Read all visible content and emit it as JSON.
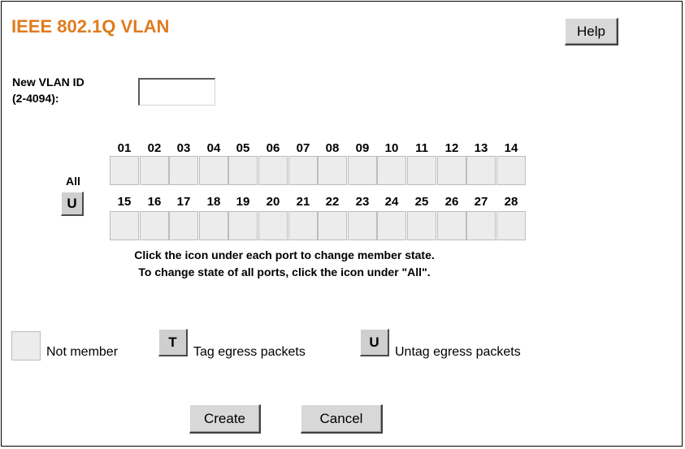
{
  "page": {
    "title": "IEEE 802.1Q VLAN",
    "help_label": "Help"
  },
  "vlan_id": {
    "label_line1": "New VLAN ID",
    "label_line2": "(2-4094):",
    "value": ""
  },
  "ports": {
    "row1": [
      "01",
      "02",
      "03",
      "04",
      "05",
      "06",
      "07",
      "08",
      "09",
      "10",
      "11",
      "12",
      "13",
      "14"
    ],
    "row2": [
      "15",
      "16",
      "17",
      "18",
      "19",
      "20",
      "21",
      "22",
      "23",
      "24",
      "25",
      "26",
      "27",
      "28"
    ],
    "all_label": "All",
    "all_state": "U"
  },
  "instructions": {
    "line1": "Click the icon under each port to change member state.",
    "line2": "To change state of all ports, click the icon under \"All\"."
  },
  "legend": {
    "not_member": "Not member",
    "tag_icon": "T",
    "tag_label": "Tag egress packets",
    "untag_icon": "U",
    "untag_label": "Untag egress packets"
  },
  "actions": {
    "create_label": "Create",
    "cancel_label": "Cancel"
  },
  "colors": {
    "title": "#e07b1f",
    "button_face": "#d8d8d8",
    "cell_empty": "#ececec"
  }
}
